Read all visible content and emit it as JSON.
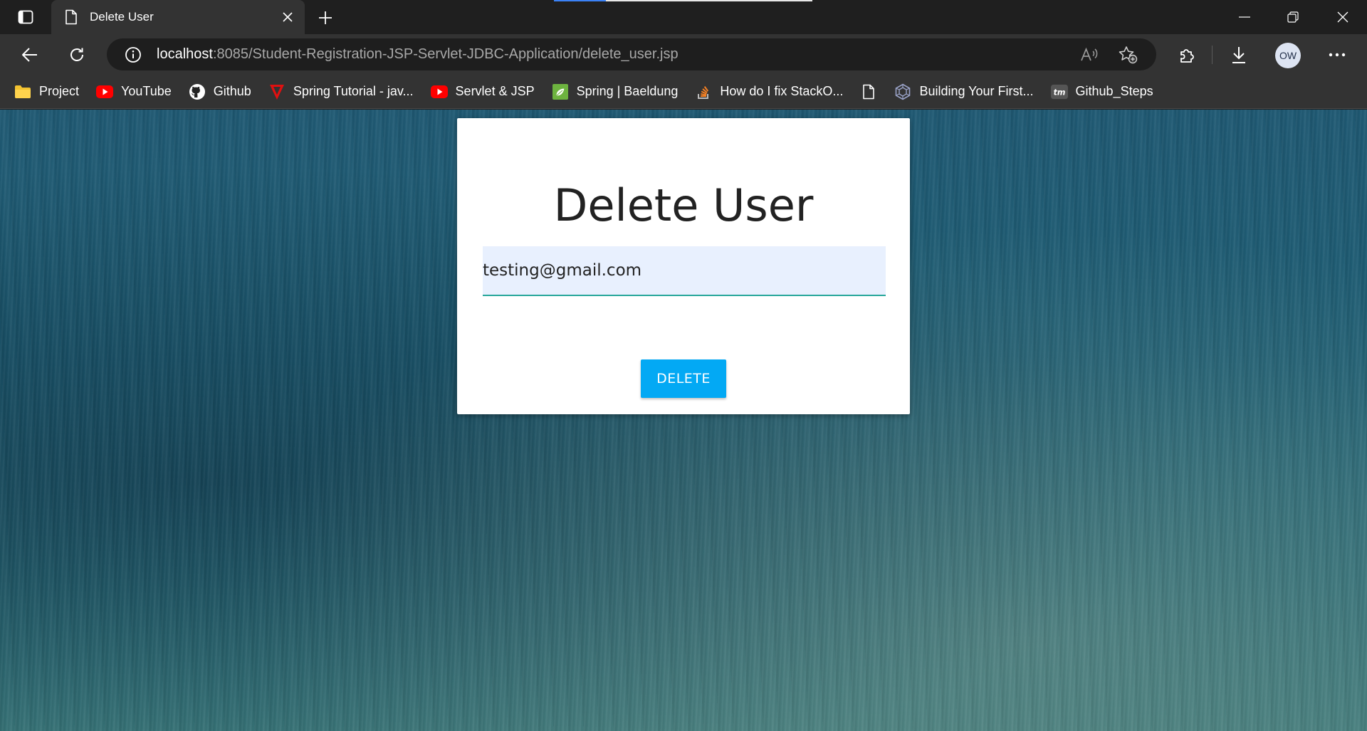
{
  "browser": {
    "tab": {
      "title": "Delete User"
    },
    "address_bar": {
      "host": "localhost",
      "path": ":8085/Student-Registration-JSP-Servlet-JDBC-Application/delete_user.jsp"
    },
    "profile_initials": "OW",
    "bookmarks": [
      {
        "label": "Project",
        "icon": "folder-icon"
      },
      {
        "label": "YouTube",
        "icon": "youtube-icon"
      },
      {
        "label": "Github",
        "icon": "github-icon"
      },
      {
        "label": "Spring Tutorial - jav...",
        "icon": "javatpoint-icon"
      },
      {
        "label": "Servlet & JSP",
        "icon": "youtube-icon"
      },
      {
        "label": "Spring | Baeldung",
        "icon": "spring-leaf-icon"
      },
      {
        "label": "How do I fix StackO...",
        "icon": "stackoverflow-icon"
      },
      {
        "label": "",
        "icon": "page-icon"
      },
      {
        "label": "Building Your First...",
        "icon": "hexagon-icon"
      },
      {
        "label": "Github_Steps",
        "icon": "tm-icon"
      }
    ]
  },
  "page": {
    "heading": "Delete User",
    "email_input": {
      "value": "testing@gmail.com"
    },
    "delete_button": "DELETE"
  },
  "colors": {
    "button": "#03a9f4",
    "input_underline": "#26a69a",
    "input_background": "#e8f0fe",
    "page_background": "#1f5973"
  }
}
